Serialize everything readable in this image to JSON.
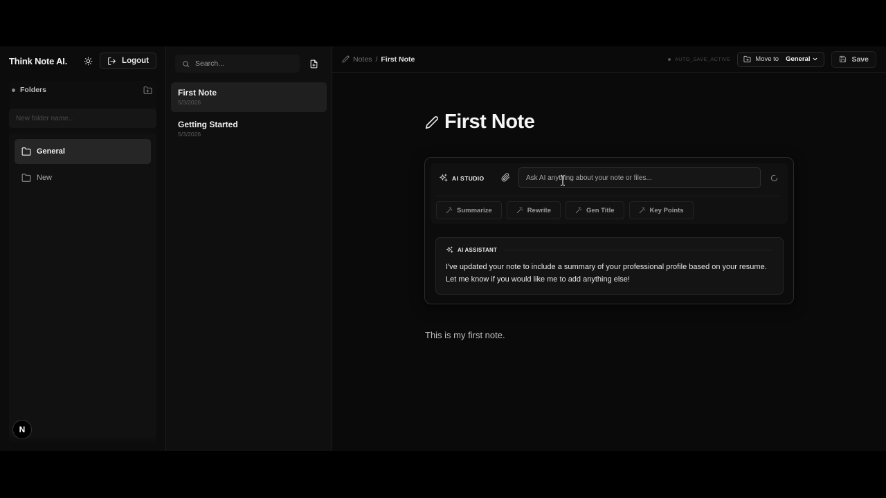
{
  "sidebar": {
    "brand": "Think Note AI.",
    "logout_label": "Logout",
    "folders_label": "Folders",
    "new_folder_placeholder": "New folder name...",
    "folders": [
      {
        "label": "General",
        "active": true
      },
      {
        "label": "New",
        "active": false
      }
    ],
    "badge": "N"
  },
  "notes_list": {
    "search_placeholder": "Search...",
    "items": [
      {
        "title": "First Note",
        "date": "5/3/2026",
        "active": true
      },
      {
        "title": "Getting Started",
        "date": "5/3/2026",
        "active": false
      }
    ]
  },
  "topbar": {
    "breadcrumb_root": "Notes",
    "breadcrumb_sep": "/",
    "breadcrumb_current": "First Note",
    "autosave": "AUTO_SAVE_ACTIVE",
    "move_to_label": "Move to",
    "move_to_value": "General",
    "save_label": "Save"
  },
  "editor": {
    "title": "First Note",
    "body": "This is my first note."
  },
  "ai_studio": {
    "label": "AI STUDIO",
    "input_placeholder": "Ask AI anything about your note or files...",
    "actions": [
      "Summarize",
      "Rewrite",
      "Gen Title",
      "Key Points"
    ]
  },
  "assistant": {
    "label": "AI ASSISTANT",
    "message": "I've updated your note to include a summary of your professional profile based on your resume. Let me know if you would like me to add anything else!"
  },
  "icons": {
    "theme": "sun-icon",
    "logout": "logout-icon",
    "new_folder": "folder-plus-icon",
    "folder": "folder-icon",
    "search": "search-icon",
    "new_note": "file-plus-icon",
    "edit": "pencil-icon",
    "move": "folder-move-icon",
    "save": "save-icon",
    "sparkles": "sparkles-icon",
    "attach": "paperclip-icon",
    "wand": "wand-icon",
    "spinner": "loader-icon"
  }
}
